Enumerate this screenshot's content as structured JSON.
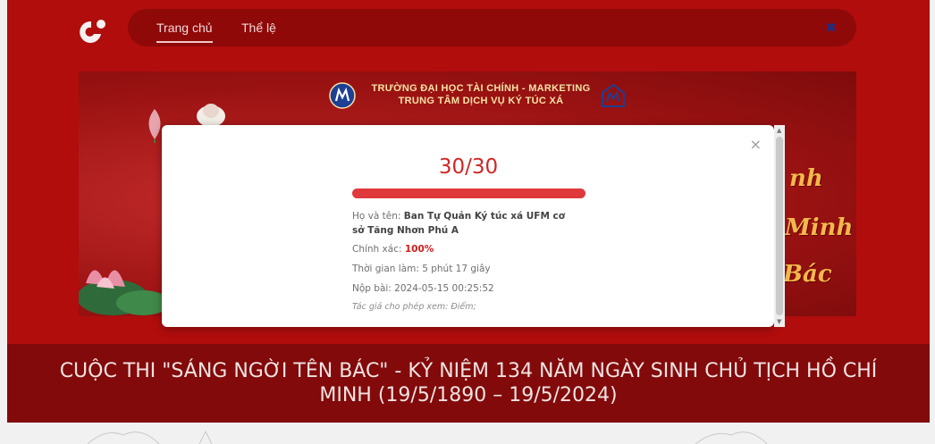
{
  "nav": {
    "items": [
      "Trang chủ",
      "Thể lệ"
    ],
    "close_symbol": "✖"
  },
  "banner": {
    "school_line1": "TRƯỜNG ĐẠI HỌC TÀI CHÍNH - MARKETING",
    "school_line2": "TRUNG TÂM DỊCH VỤ KÝ TÚC XÁ",
    "gold_text_1": "nh",
    "gold_text_2": "Minh",
    "gold_text_3": "Bác"
  },
  "contest_title": "CUỘC THI \"SÁNG NGỜI TÊN BÁC\" - KỶ NIỆM 134 NĂM NGÀY SINH CHỦ TỊCH HỒ CHÍ MINH (19/5/1890 – 19/5/2024)",
  "result": {
    "score_text": "30/30",
    "progress_fraction": 1.0,
    "name_label": "Họ và tên:",
    "name_value": "Ban Tự Quản Ký túc xá UFM cơ sở Tăng Nhơn Phú A",
    "accuracy_label": "Chính xác:",
    "accuracy_value": "100%",
    "time_text": "Thời gian làm: 5 phút 17 giây",
    "submitted_text": "Nộp bài: 2024-05-15 00:25:52",
    "note_text": "Tác giả cho phép xem: Điểm;"
  },
  "modal_close_symbol": "×",
  "colors": {
    "primary_red": "#b10d0d",
    "score_red": "#cf2727",
    "progress_red": "#e0393b",
    "gold": "#f2b84b"
  },
  "icons": [
    "app-logo-icon",
    "close-icon",
    "school-logo-icon",
    "lotus-icon"
  ]
}
